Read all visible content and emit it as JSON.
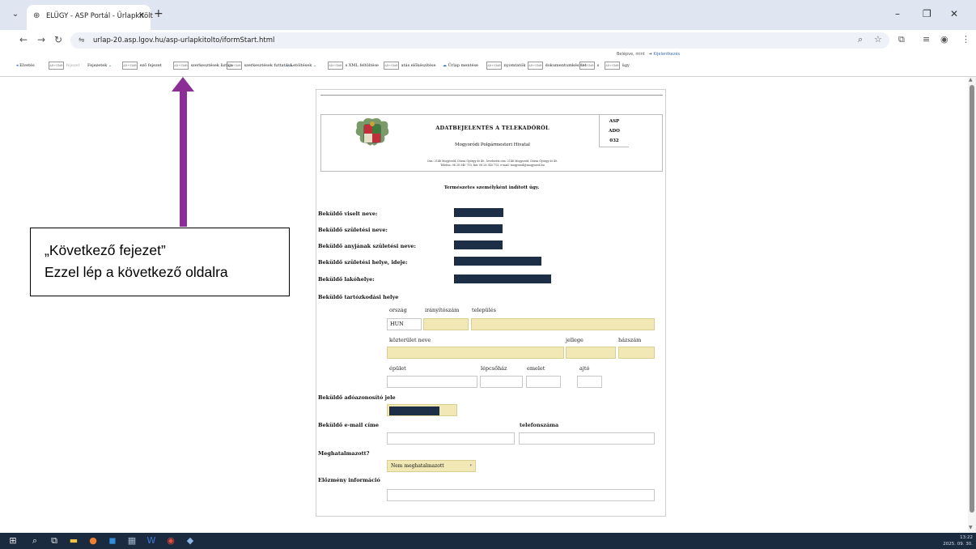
{
  "browser": {
    "tab_title": "ELÜGY - ASP Portál - Űrlapkitölt",
    "url": "urlap-20.asp.lgov.hu/asp-urlapkitolto/iformStart.html",
    "icons": [
      "chevron-down-icon",
      "globe-icon",
      "close-icon",
      "plus-icon",
      "back-icon",
      "forward-icon",
      "reload-icon",
      "tune-icon",
      "zoom-icon",
      "star-icon",
      "extensions-icon",
      "reading-list-icon",
      "profile-icon",
      "menu-icon"
    ]
  },
  "toolbar": {
    "login_text": "Belépve, mint",
    "logout": "Kijelentkezés",
    "items": {
      "elvetes": "Elvetés",
      "elozo": "fejezet",
      "fejezetek": "Fejezetek",
      "kovetkezo": "ező fejezet",
      "hibalista": "szerkesztések listája",
      "ellenorzes": "szerkesztések futtatása",
      "letoltesek": "Letöltések",
      "xml": "s XML feltöltése",
      "nyomtatas": "atás előkészítése",
      "mentes": "Űrlap mentése",
      "csatolmany": "nyomtatók",
      "kuldes": "dokumentumkészlet",
      "s": "s",
      "ugy": "ügy"
    },
    "alt_badge": "Alt+Shift"
  },
  "form": {
    "header": {
      "title": "ADATBEJELENTÉS A TELEKADÓRÓL",
      "office": "Mogyoródi Polgármesteri Hivatal",
      "address_line1": "Cím: 2146 Mogyoród, Dózsa György út 40., levelezési cím: 2146 Mogyoród, Dózsa György út 40.",
      "address_line2": "Telefon: 06 28 540 710, fax: 06 28 540 715, e-mail: mogyorod@mogyorod.hu",
      "code_lines": [
        "ASP",
        "ADO",
        "032"
      ]
    },
    "subtitle": "Természetes személyként indított ügy.",
    "labels": {
      "viselt_nev": "Beküldő viselt neve:",
      "szuletesi_nev": "Beküldő születési neve:",
      "anyja_neve": "Beküldő anyjának születési neve:",
      "szuletesi_hely": "Beküldő születési helye, ideje:",
      "lakohely": "Beküldő lakóhelye:",
      "tartozkodasi_hely": "Beküldő tartózkodási helye",
      "adoazonosito": "Beküldő adóazonosító jele",
      "email": "Beküldő e-mail címe",
      "telefon": "telefonszáma",
      "meghatalmazott": "Meghatalmazott?",
      "elozmeny": "Előzmény információ"
    },
    "address_columns": {
      "orszag": "ország",
      "iranyitoszam": "irányítószám",
      "telepules": "település",
      "kozterulet": "közterület neve",
      "jellege": "jellege",
      "hazszam": "házszám",
      "epulet": "épület",
      "lepcsohaz": "lépcsőház",
      "emelet": "emelet",
      "ajto": "ajtó"
    },
    "values": {
      "orszag": "HUN",
      "meghatalmazott": "Nem meghatalmazott"
    }
  },
  "annotation": {
    "line1": "„Következő fejezet”",
    "line2": "Ezzel lép a következő oldalra",
    "arrow_color": "#8b2f96"
  },
  "taskbar": {
    "time": "13:22",
    "date": "2025. 09. 30."
  }
}
